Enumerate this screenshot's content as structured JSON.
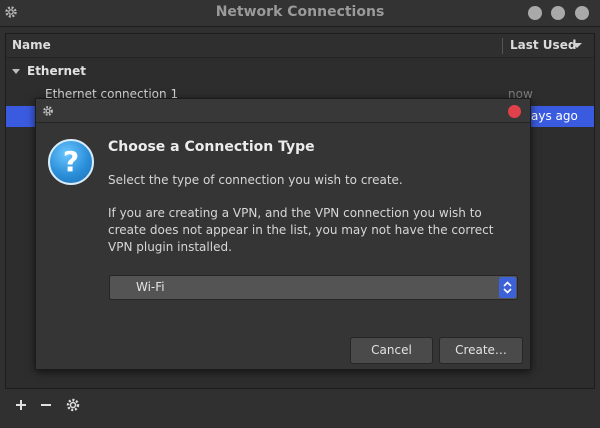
{
  "window": {
    "title": "Network Connections"
  },
  "list": {
    "columns": {
      "name": "Name",
      "last_used": "Last Used"
    },
    "group": {
      "label": "Ethernet"
    },
    "rows": [
      {
        "name": "Ethernet connection 1",
        "last_used": "now"
      },
      {
        "name": "",
        "last_used": "ays ago"
      }
    ]
  },
  "toolbar": {
    "add_icon": "plus-icon",
    "remove_icon": "minus-icon",
    "settings_icon": "gear-icon"
  },
  "dialog": {
    "heading": "Choose a Connection Type",
    "text1": "Select the type of connection you wish to create.",
    "text2": "If you are creating a VPN, and the VPN connection you wish to create does not appear in the list, you may not have the correct VPN plugin installed.",
    "combo_value": "Wi-Fi",
    "cancel_label": "Cancel",
    "create_label": "Create…",
    "icon": "question-icon"
  },
  "colors": {
    "selection": "#3a5be0",
    "close": "#e0414b",
    "accent": "#3d62d8"
  }
}
